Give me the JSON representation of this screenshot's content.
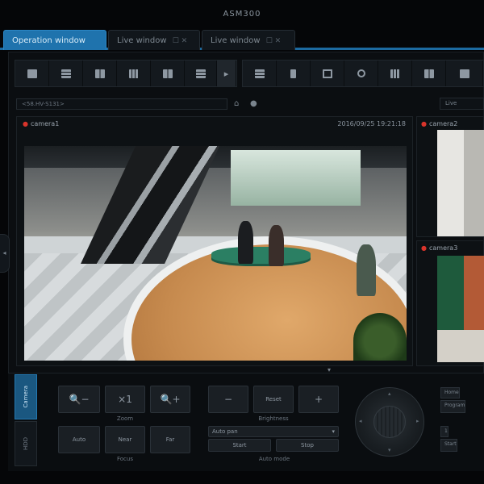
{
  "app": {
    "title": "ASM300"
  },
  "tabs": [
    {
      "label": "Operation window",
      "active": true
    },
    {
      "label": "Live window",
      "close": "☐ ✕",
      "active": false
    },
    {
      "label": "Live window",
      "close": "☐ ✕",
      "active": false
    }
  ],
  "toolbar": {
    "layout_icons": [
      "single-layout-icon",
      "split-rows-icon",
      "split-2-icon",
      "split-3-icon",
      "split-4-icon",
      "split-grid-icon"
    ],
    "more_icon": "▸",
    "tool_icons": [
      "sequence-icon",
      "record-icon",
      "fullscreen-icon",
      "zoom-icon",
      "snapshot-icon",
      "export-icon",
      "settings-icon"
    ]
  },
  "selector": {
    "value": "<58.HV-S131>"
  },
  "live_badge": "Live",
  "camera1": {
    "name": "camera1",
    "timestamp": "2016/09/25 19:21:18"
  },
  "camera2": {
    "name": "camera2"
  },
  "camera3": {
    "name": "camera3"
  },
  "side_tabs": [
    {
      "label": "Camera",
      "active": true
    },
    {
      "label": "HDD",
      "active": false
    }
  ],
  "zoom": {
    "label": "Zoom",
    "out": "🔍−",
    "x1": "×1",
    "in": "🔍+"
  },
  "focus": {
    "label": "Focus",
    "auto": "Auto",
    "near": "Near",
    "far": "Far"
  },
  "brightness": {
    "label": "Brightness",
    "minus": "−",
    "reset": "Reset",
    "plus": "+"
  },
  "auto_mode": {
    "label": "Auto mode",
    "select": "Auto pan",
    "start": "Start",
    "stop": "Stop"
  },
  "right_controls": {
    "preset_select": "Home",
    "program": "Program",
    "number": "1",
    "start": "Start"
  },
  "colors": {
    "accent": "#1f73ad",
    "recording_dot": "#d9342b"
  }
}
